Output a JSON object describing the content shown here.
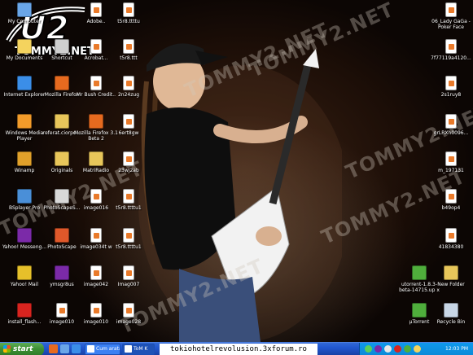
{
  "watermark_text": "TOMMY2.NET",
  "logo": {
    "mark": "U2",
    "site": "TOMMY2.NET"
  },
  "desktop_icons": [
    {
      "label": "My Computer",
      "icon": "my-computer-icon",
      "col": 0,
      "row": 0,
      "color": "#6aa6e8"
    },
    {
      "label": "My Documents",
      "icon": "my-documents-icon",
      "col": 0,
      "row": 1,
      "color": "#f4d35e"
    },
    {
      "label": "Internet Explorer",
      "icon": "internet-explorer-icon",
      "col": 0,
      "row": 2,
      "color": "#3b8ee8"
    },
    {
      "label": "Windows Media Player",
      "icon": "media-player-icon",
      "col": 0,
      "row": 3,
      "color": "#f29b2a"
    },
    {
      "label": "Winamp",
      "icon": "winamp-icon",
      "col": 0,
      "row": 4,
      "color": "#e0a02a"
    },
    {
      "label": "BSplayer Pro",
      "icon": "bsplayer-icon",
      "col": 0,
      "row": 5,
      "color": "#4a8fd8"
    },
    {
      "label": "Yahoo! Messeng...",
      "icon": "yahoo-messenger-icon",
      "col": 0,
      "row": 6,
      "color": "#7b2aa8"
    },
    {
      "label": "Yahoo! Mail",
      "icon": "yahoo-mail-icon",
      "col": 0,
      "row": 7,
      "color": "#e6c02a"
    },
    {
      "label": "install_flash...",
      "icon": "flash-installer-icon",
      "col": 0,
      "row": 8,
      "color": "#d8241f"
    },
    {
      "label": "Shortcut",
      "icon": "shortcut-icon",
      "col": 1,
      "row": 1,
      "color": "#cfcfcf"
    },
    {
      "label": "Mozilla Firefox",
      "icon": "firefox-icon",
      "col": 1,
      "row": 2,
      "color": "#e66a1f"
    },
    {
      "label": "referat.ciorpo...",
      "icon": "folder-icon",
      "col": 1,
      "row": 3,
      "color": "#e8c65a"
    },
    {
      "label": "Originals",
      "icon": "folder-icon",
      "col": 1,
      "row": 4,
      "color": "#e8c65a"
    },
    {
      "label": "PhotoScapeS...",
      "icon": "photoscape-icon",
      "col": 1,
      "row": 5,
      "color": "#d8d8d8"
    },
    {
      "label": "PhotoScape",
      "icon": "photoscape-icon",
      "col": 1,
      "row": 6,
      "color": "#e0582a"
    },
    {
      "label": "ymsgr8us",
      "icon": "yahoo-setup-icon",
      "col": 1,
      "row": 7,
      "color": "#7b2aa8"
    },
    {
      "label": "image010",
      "icon": "image-file-icon",
      "col": 1,
      "row": 8,
      "color": "#ffffff"
    },
    {
      "label": "Adobe..",
      "icon": "word-doc-icon",
      "col": 2,
      "row": 0,
      "color": "#ffffff"
    },
    {
      "label": "Acrobat...",
      "icon": "word-doc-icon",
      "col": 2,
      "row": 1,
      "color": "#ffffff"
    },
    {
      "label": "Mr Bush Credit..",
      "icon": "word-doc-icon",
      "col": 2,
      "row": 2,
      "color": "#2b5fbf"
    },
    {
      "label": "Mozilla Firefox 3.1 Beta 2",
      "icon": "firefox-icon",
      "col": 2,
      "row": 3,
      "color": "#e66a1f"
    },
    {
      "label": "MatriRadio",
      "icon": "radio-icon",
      "col": 2,
      "row": 4,
      "color": "#e8c65a"
    },
    {
      "label": "image016",
      "icon": "image-file-icon",
      "col": 2,
      "row": 5,
      "color": "#ffffff"
    },
    {
      "label": "image034t w",
      "icon": "image-file-icon",
      "col": 2,
      "row": 6,
      "color": "#ffffff"
    },
    {
      "label": "image042",
      "icon": "image-file-icon",
      "col": 2,
      "row": 7,
      "color": "#ffffff"
    },
    {
      "label": "image010",
      "icon": "image-file-icon",
      "col": 2,
      "row": 8,
      "color": "#ffffff"
    },
    {
      "label": "t5r8.ttttu",
      "icon": "image-file-icon",
      "col": 3,
      "row": 0,
      "color": "#ffffff"
    },
    {
      "label": "t5r8.ttt",
      "icon": "image-file-icon",
      "col": 3,
      "row": 1,
      "color": "#ffffff"
    },
    {
      "label": "2n24zug",
      "icon": "image-file-icon",
      "col": 3,
      "row": 2,
      "color": "#ffffff"
    },
    {
      "label": "6ert8gw",
      "icon": "image-file-icon",
      "col": 3,
      "row": 3,
      "color": "#ffffff"
    },
    {
      "label": "23wj2ab",
      "icon": "image-file-icon",
      "col": 3,
      "row": 4,
      "color": "#ffffff"
    },
    {
      "label": "t5r8.ttttu1",
      "icon": "image-file-icon",
      "col": 3,
      "row": 5,
      "color": "#ffffff"
    },
    {
      "label": "t5r8.ttttu1",
      "icon": "image-file-icon",
      "col": 3,
      "row": 6,
      "color": "#ffffff"
    },
    {
      "label": "Imag007",
      "icon": "image-file-icon",
      "col": 3,
      "row": 7,
      "color": "#ffffff"
    },
    {
      "label": "image028",
      "icon": "image-file-icon",
      "col": 3,
      "row": 8,
      "color": "#ffffff"
    },
    {
      "label": "06_Lady GaGa - Poker Face",
      "icon": "audio-file-icon",
      "col": 5,
      "row": 0,
      "color": "#ffffff"
    },
    {
      "label": "7f77119a4120...",
      "icon": "image-file-icon",
      "col": 5,
      "row": 1,
      "color": "#ffffff"
    },
    {
      "label": "2s1ruy8",
      "icon": "image-file-icon",
      "col": 5,
      "row": 2,
      "color": "#ffffff"
    },
    {
      "label": "grLRXh0096...",
      "icon": "image-file-icon",
      "col": 5,
      "row": 3,
      "color": "#ffffff"
    },
    {
      "label": "m_197131",
      "icon": "image-file-icon",
      "col": 5,
      "row": 4,
      "color": "#ffffff"
    },
    {
      "label": "b49op4",
      "icon": "image-file-icon",
      "col": 5,
      "row": 5,
      "color": "#ffffff"
    },
    {
      "label": "41834380",
      "icon": "image-file-icon",
      "col": 5,
      "row": 6,
      "color": "#ffffff"
    },
    {
      "label": "New Folder",
      "icon": "folder-icon",
      "col": 5,
      "row": 7,
      "color": "#e8c65a"
    },
    {
      "label": "Recycle Bin",
      "icon": "recycle-bin-icon",
      "col": 5,
      "row": 8,
      "color": "#c8d6e6"
    },
    {
      "label": "utorrent-1.8.3-beta-14715.up x",
      "icon": "utorrent-icon",
      "col": 4,
      "row": 7,
      "color": "#4fae3c"
    },
    {
      "label": "µTorrent",
      "icon": "utorrent-icon",
      "col": 4,
      "row": 8,
      "color": "#4fae3c"
    }
  ],
  "taskbar": {
    "start_label": "start",
    "quick_launch": [
      {
        "icon": "firefox-quick-icon",
        "color": "#e66a1f"
      },
      {
        "icon": "show-desktop-icon",
        "color": "#6aa6e8"
      },
      {
        "icon": "ie-quick-icon",
        "color": "#3b8ee8"
      }
    ],
    "tasks": [
      {
        "label": "Cum arata desktopul ...",
        "icon": "firefox-task-icon",
        "active": false
      },
      {
        "label": "ToM K",
        "icon": "paint-task-icon",
        "active": true
      }
    ],
    "tray_icons": [
      {
        "icon": "tray-network-icon",
        "color": "#5ad05a"
      },
      {
        "icon": "tray-yahoo-icon",
        "color": "#7b2aa8"
      },
      {
        "icon": "tray-volume-icon",
        "color": "#e8e8e8"
      },
      {
        "icon": "tray-antivirus-icon",
        "color": "#d8241f"
      },
      {
        "icon": "tray-utorrent-icon",
        "color": "#4fae3c"
      },
      {
        "icon": "tray-shield-icon",
        "color": "#f4d35e"
      }
    ],
    "clock": "12:03 PM"
  },
  "status_banner": "tokiohotelrevolusion.3xforum.ro"
}
